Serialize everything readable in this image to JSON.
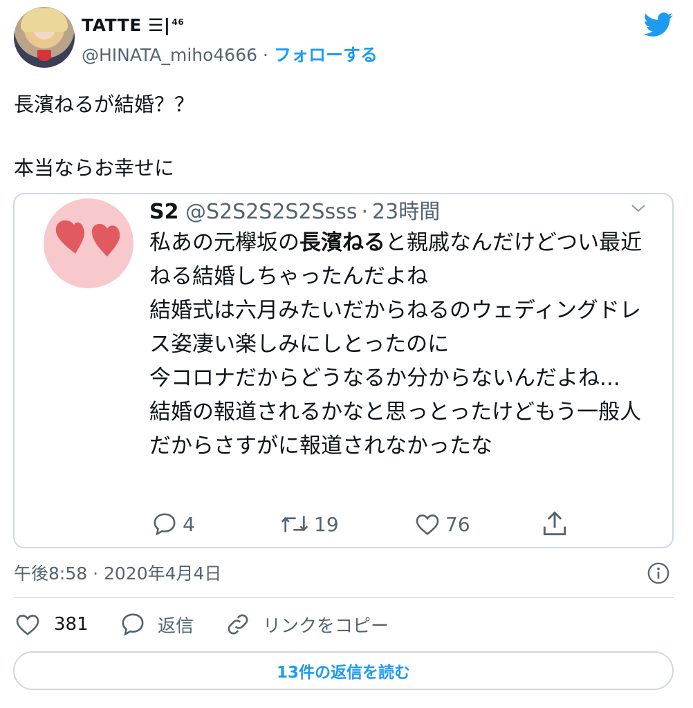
{
  "tweet": {
    "author_name": "TATTE ☰|",
    "author_name_sup": "46",
    "handle": "@HINATA_miho4666",
    "separator": "·",
    "follow_label": "フォローする",
    "text_line1": "長濱ねるが結婚？？",
    "text_line2": "本当ならお幸せに",
    "timestamp": "午後8:58 · 2020年4月4日",
    "likes": "381",
    "reply_label": "返信",
    "copy_link_label": "リンクをコピー",
    "read_replies_label": "13件の返信を読む"
  },
  "quoted": {
    "name": "S2",
    "handle": "@S2S2S2S2Ssss",
    "separator": "·",
    "time": "23時間",
    "text_before_bold": "私あの元欅坂の",
    "text_bold": "長濱ねる",
    "text_after_bold": "と親戚なんだけどつい最近ねる結婚しちゃったんだよね\n結婚式は六月みたいだからねるのウェディングドレス姿凄い楽しみにしとったのに\n今コロナだからどうなるか分からないんだよね...\n結婚の報道されるかなと思っとったけどもう一般人だからさすがに報道されなかったな",
    "replies": "4",
    "retweets": "19",
    "likes": "76"
  },
  "colors": {
    "accent": "#1d9bf0",
    "secondary_text": "#536471",
    "border": "#cfd9de",
    "heart_red": "#e05a5f",
    "avatar_pink": "#f8c9cc"
  },
  "icons": [
    "twitter-bird-icon",
    "chevron-down-icon",
    "reply-icon",
    "retweet-icon",
    "like-icon",
    "share-icon",
    "info-icon",
    "link-icon"
  ]
}
